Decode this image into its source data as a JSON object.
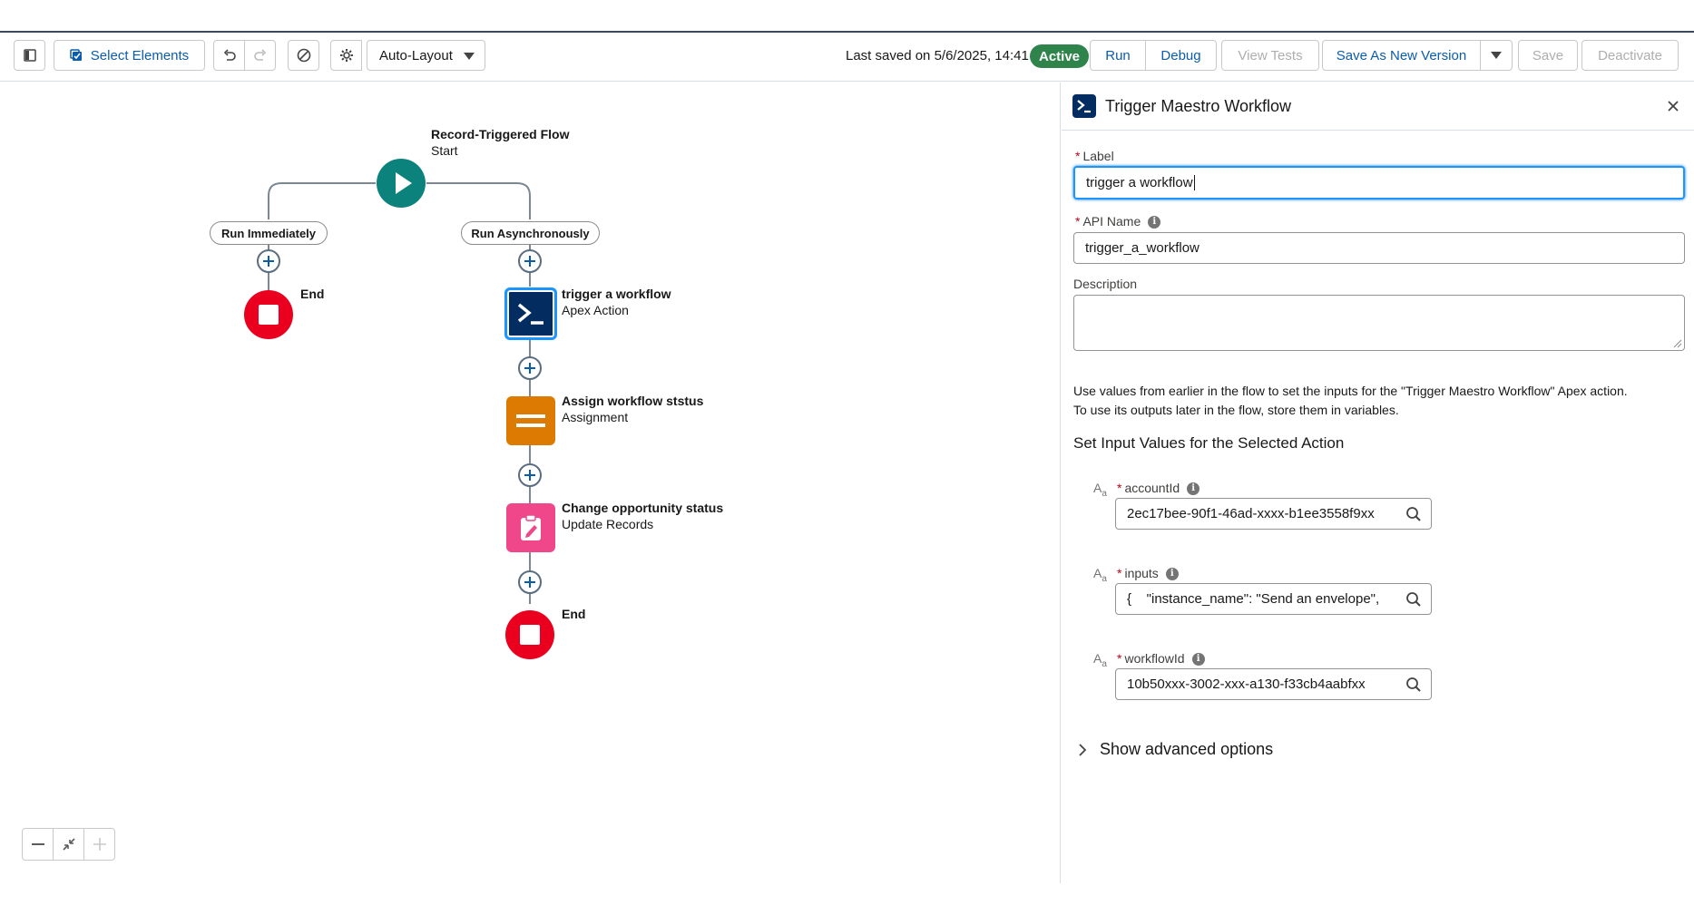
{
  "toolbar": {
    "select_elements": "Select Elements",
    "layout_select": "Auto-Layout",
    "last_saved": "Last saved on 5/6/2025, 14:41",
    "status_badge": "Active",
    "run": "Run",
    "debug": "Debug",
    "view_tests": "View Tests",
    "save_new_version": "Save As New Version",
    "save": "Save",
    "deactivate": "Deactivate"
  },
  "canvas": {
    "start": {
      "title": "Record-Triggered Flow",
      "subtitle": "Start"
    },
    "branch_left": "Run Immediately",
    "branch_right": "Run Asynchronously",
    "end_left": "End",
    "end_right": "End",
    "nodes": [
      {
        "title": "trigger a workflow",
        "subtitle": "Apex Action",
        "color": "#032d60",
        "icon": "apex-action-icon"
      },
      {
        "title": "Assign workflow ststus",
        "subtitle": "Assignment",
        "color": "#dd7a01",
        "icon": "assignment-icon"
      },
      {
        "title": "Change opportunity status",
        "subtitle": "Update Records",
        "color": "#f0468a",
        "icon": "update-records-icon"
      }
    ]
  },
  "panel": {
    "title": "Trigger Maestro Workflow",
    "label_label": "Label",
    "label_value": "trigger a workflow",
    "api_label": "API Name",
    "api_value": "trigger_a_workflow",
    "description_label": "Description",
    "description_value": "",
    "help_line1": "Use values from earlier in the flow to set the inputs for the \"Trigger Maestro Workflow\" Apex action.",
    "help_line2": "To use its outputs later in the flow, store them in variables.",
    "section_title": "Set Input Values for the Selected Action",
    "inputs": [
      {
        "name": "accountId",
        "value": "2ec17bee-90f1-46ad-xxxx-b1ee3558f9xx"
      },
      {
        "name": "inputs",
        "value": "{    \"instance_name\": \"Send an envelope\","
      },
      {
        "name": "workflowId",
        "value": "10b50xxx-3002-xxx-a130-f33cb4aabfxx"
      }
    ],
    "advanced": "Show advanced options"
  }
}
